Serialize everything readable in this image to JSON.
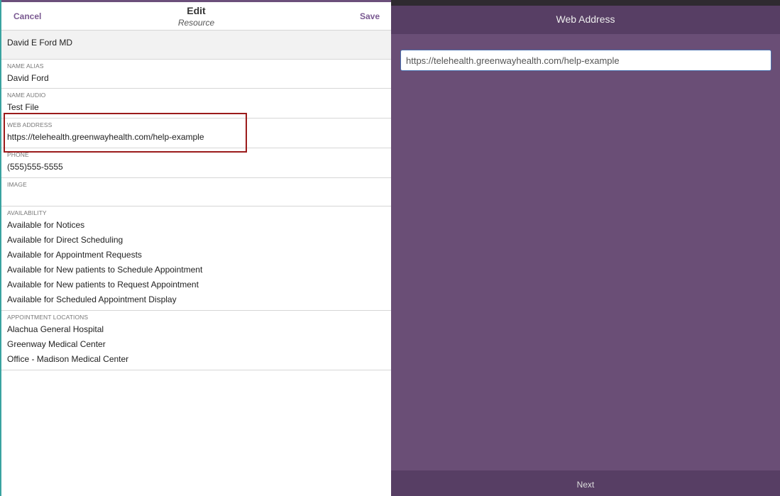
{
  "edit_panel": {
    "cancel_label": "Cancel",
    "title": "Edit",
    "subtitle": "Resource",
    "save_label": "Save",
    "resource_name": "David E Ford MD",
    "fields": {
      "name_alias": {
        "label": "NAME ALIAS",
        "value": "David Ford"
      },
      "name_audio": {
        "label": "NAME AUDIO",
        "value": "Test File"
      },
      "web_address": {
        "label": "WEB ADDRESS",
        "value": "https://telehealth.greenwayhealth.com/help-example"
      },
      "phone": {
        "label": "PHONE",
        "value": "(555)555-5555"
      },
      "image": {
        "label": "IMAGE",
        "value": ""
      }
    },
    "availability": {
      "label": "AVAILABILITY",
      "items": [
        "Available for Notices",
        "Available for Direct Scheduling",
        "Available for Appointment Requests",
        "Available for New patients to Schedule Appointment",
        "Available for New patients to Request Appointment",
        "Available for Scheduled Appointment Display"
      ]
    },
    "appointment_locations": {
      "label": "APPOINTMENT LOCATIONS",
      "items": [
        "Alachua General Hospital",
        "Greenway Medical Center",
        "Office - Madison Medical Center"
      ]
    }
  },
  "web_address_modal": {
    "title": "Web Address",
    "input_value": "https://telehealth.greenwayhealth.com/help-example",
    "next_label": "Next"
  },
  "colors": {
    "accent_purple": "#7b5a92",
    "modal_background": "#6a4e76",
    "modal_header": "#573e64",
    "highlight_border": "#9b1b1b"
  }
}
